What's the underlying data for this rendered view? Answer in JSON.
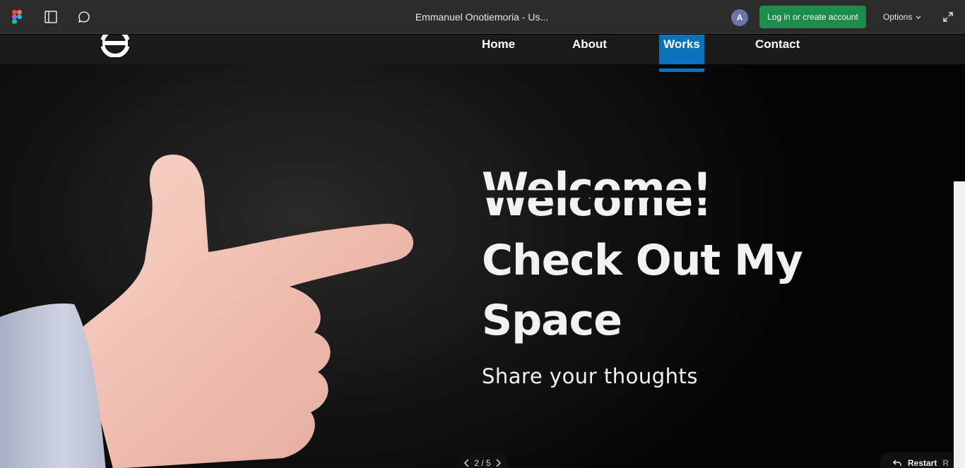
{
  "toolbar": {
    "document_title": "Emmanuel Onotiemoria - Us...",
    "avatar_initial": "A",
    "login_label": "Log in or create account",
    "options_label": "Options"
  },
  "site": {
    "nav": {
      "items": [
        "Home",
        "About",
        "Works",
        "Contact"
      ],
      "active": "Works"
    },
    "hero": {
      "welcome": "Welcome!",
      "line2": "Check Out My",
      "line3": "Space",
      "subtitle": "Share your thoughts"
    }
  },
  "prototype_controls": {
    "page_indicator": "2 / 5",
    "restart_label": "Restart",
    "restart_shortcut": "R"
  },
  "colors": {
    "toolbar_bg": "#2c2c2c",
    "login_green": "#1c8b4b",
    "nav_active_blue": "#0a72b8",
    "avatar_purple": "#6a74a6"
  }
}
